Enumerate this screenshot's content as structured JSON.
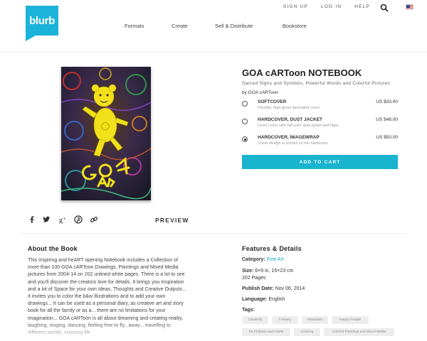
{
  "brand": {
    "logo_text": "blurb",
    "accent": "#1bb3d9"
  },
  "top_links": {
    "sign_up": "SIGN UP",
    "log_in": "LOG IN",
    "help": "HELP"
  },
  "main_nav": [
    "Formats",
    "Create",
    "Sell & Distribute",
    "Bookstore"
  ],
  "product": {
    "title": "GOA cARToon NOTEBOOK",
    "subtitle": "Sacred Signs and Symbols, Powerful Words and Colorful Pictures",
    "author": "by GOA cARToon",
    "cover_text": "GOA ARTE",
    "options": [
      {
        "name": "SOFTCOVER",
        "desc": "Flexible, high-gloss laminated cover",
        "price": "US $33.00",
        "selected": false
      },
      {
        "name": "HARDCOVER, DUST JACKET",
        "desc": "Linen cover with full-color dust jacket and flaps",
        "price": "US $48.00",
        "selected": false
      },
      {
        "name": "HARDCOVER, IMAGEWRAP",
        "desc": "Cover design is printed on the hardcover",
        "price": "US $50.00",
        "selected": true
      }
    ],
    "add_to_cart": "ADD TO CART",
    "preview": "PREVIEW"
  },
  "share_icons": [
    "facebook-icon",
    "twitter-icon",
    "google-plus-icon",
    "pinterest-icon",
    "link-icon"
  ],
  "about": {
    "title": "About the Book",
    "text": "This inspiring and heART opening Notebook includes a Collection of more than 100 GOA cARToon Drawings, Paintings and Mixed Media pictures from 2004-14 on 202 unlined white pages. There is a lot to see and you'll discover the creators love for details. It brings you Inspiration and a lot of Space for your own Ideas, Thoughts and Creative Outputs... It invites you to color the b&w illustrations and to add your own drawings... It can be used as a personal diary, as creative art and story book for all the family or as a... there are no limitations for your imagination... GOA cARToon is all about dreaming and creating reality, laughing, singing, dancing, feeling free to fly...away... travelling to different worlds, enjoying life"
  },
  "features": {
    "title": "Features & Details",
    "category_label": "Category:",
    "category_value": "Fine Art",
    "size_label": "Size:",
    "size_value": "6×9 in, 15×23 cm",
    "pages": "202 Pages",
    "publish_label": "Publish Date:",
    "publish_value": "Nov 06, 2014",
    "language_label": "Language:",
    "language_value": "English",
    "tags_label": "Tags:",
    "tags": [
      "Creativity",
      "Fantasy",
      "Mandalas",
      "Happy People",
      "for Children and Adults",
      "Coloring",
      "Colorful Paintings and Mixed Media"
    ]
  }
}
